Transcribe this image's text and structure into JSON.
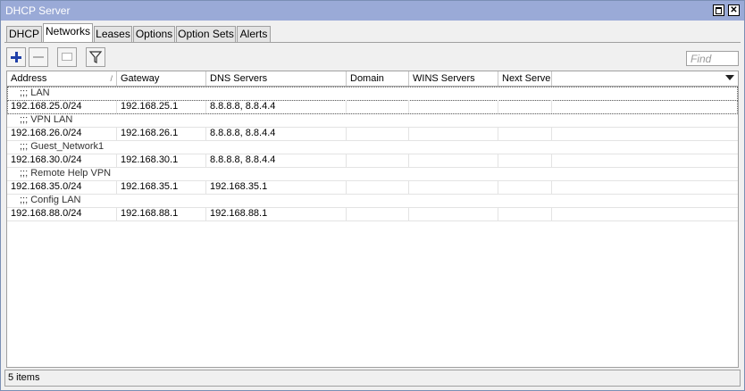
{
  "window": {
    "title": "DHCP Server"
  },
  "tabs": [
    {
      "label": "DHCP"
    },
    {
      "label": "Networks"
    },
    {
      "label": "Leases"
    },
    {
      "label": "Options"
    },
    {
      "label": "Option Sets"
    },
    {
      "label": "Alerts"
    }
  ],
  "toolbar": {
    "find_placeholder": "Find"
  },
  "table": {
    "columns": [
      "Address",
      "Gateway",
      "DNS Servers",
      "Domain",
      "WINS Servers",
      "Next Server"
    ],
    "rows": [
      {
        "comment": ";;; LAN",
        "cells": [
          "192.168.25.0/24",
          "192.168.25.1",
          "8.8.8.8, 8.8.4.4",
          "",
          "",
          ""
        ]
      },
      {
        "comment": ";;; VPN LAN",
        "cells": [
          "192.168.26.0/24",
          "192.168.26.1",
          "8.8.8.8, 8.8.4.4",
          "",
          "",
          ""
        ]
      },
      {
        "comment": ";;; Guest_Network1",
        "cells": [
          "192.168.30.0/24",
          "192.168.30.1",
          "8.8.8.8, 8.8.4.4",
          "",
          "",
          ""
        ]
      },
      {
        "comment": ";;; Remote Help VPN",
        "cells": [
          "192.168.35.0/24",
          "192.168.35.1",
          "192.168.35.1",
          "",
          "",
          ""
        ]
      },
      {
        "comment": ";;; Config LAN",
        "cells": [
          "192.168.88.0/24",
          "192.168.88.1",
          "192.168.88.1",
          "",
          "",
          ""
        ]
      }
    ]
  },
  "status": {
    "text": "5 items"
  }
}
